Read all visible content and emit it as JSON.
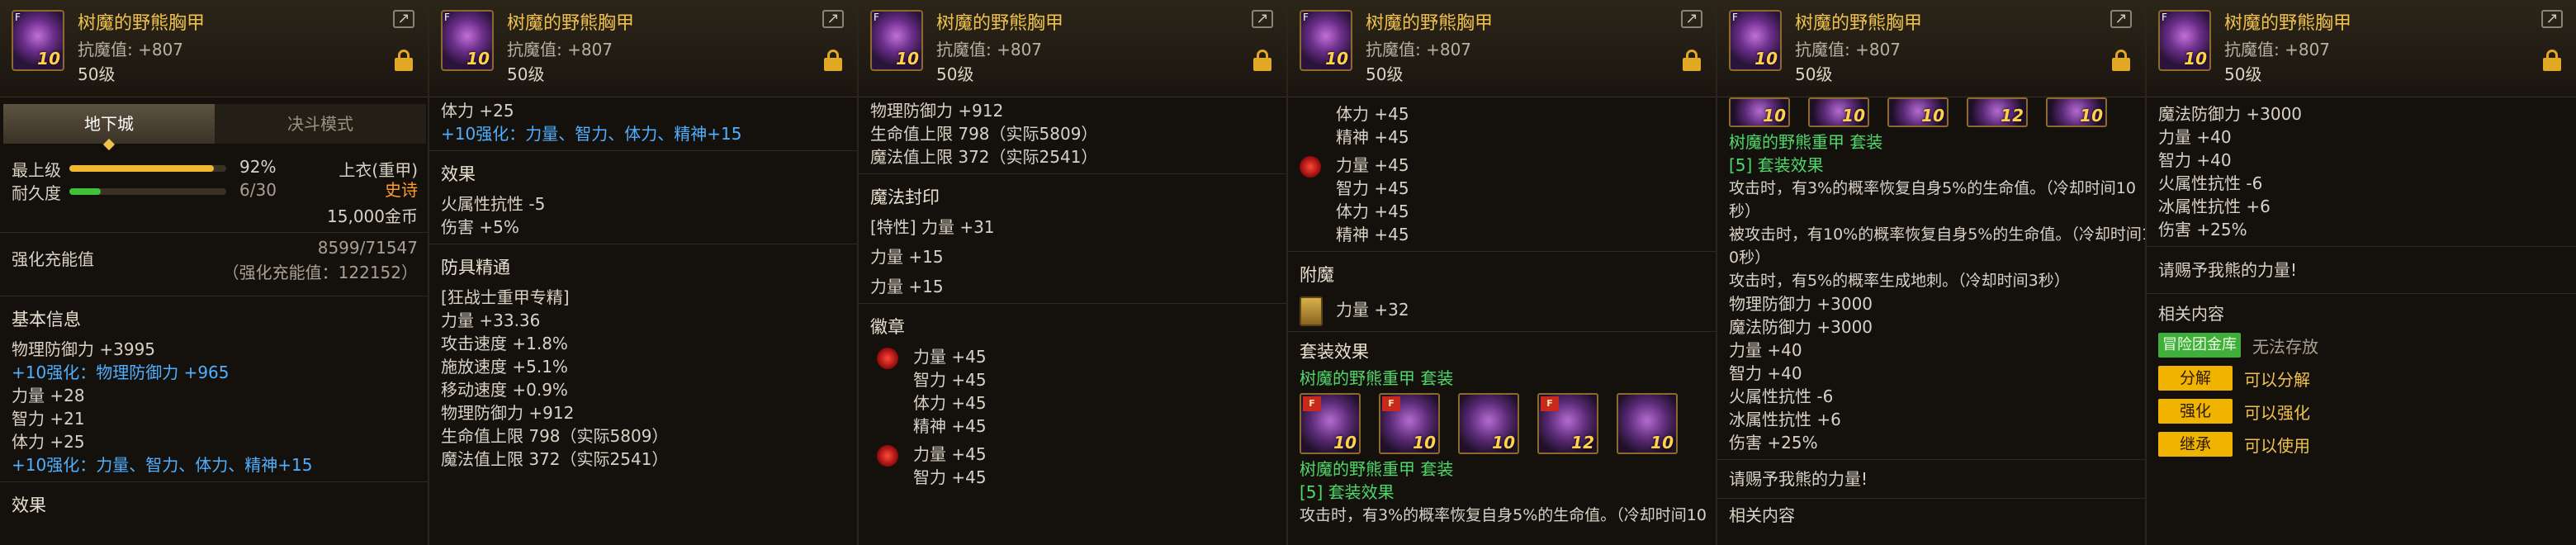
{
  "item": {
    "name": "树魔的野熊胸甲",
    "resist": "抗魔值: +807",
    "level": "50级",
    "icon_badge": "F",
    "icon_level": "10",
    "share_icon": "share-icon",
    "lock_icon": "lock-icon"
  },
  "p1": {
    "tab_dungeon": "地下城",
    "tab_duel": "决斗模式",
    "max_level_label": "最上级",
    "max_level_pct": "92%",
    "max_level_value": 0.92,
    "durability_label": "耐久度",
    "durability_value": "6/30",
    "durability_frac": 0.2,
    "slot": "上衣(重甲)",
    "rarity": "史诗",
    "price": "15,000金币",
    "enhance_label": "强化充能值",
    "enhance_value": "8599/71547",
    "enhance_sub": "（强化充能值：122152）",
    "basic_info": "基本信息",
    "lines": [
      "物理防御力 +3995",
      "+10强化：物理防御力 +965",
      "力量 +28",
      "智力 +21",
      "体力 +25",
      "+10强化：力量、智力、体力、精神+15"
    ],
    "effect": "效果"
  },
  "p2": {
    "top": [
      "体力 +25",
      "+10强化：力量、智力、体力、精神+15"
    ],
    "effect": "效果",
    "effect_lines": [
      "火属性抗性 -5",
      "伤害 +5%"
    ],
    "mastery": "防具精通",
    "mastery_lines": [
      "[狂战士重甲专精]",
      "力量 +33.36",
      "攻击速度 +1.8%",
      "施放速度 +5.1%",
      "移动速度 +0.9%",
      "物理防御力 +912",
      "生命值上限 798（实际5809）",
      "魔法值上限 372（实际2541）"
    ]
  },
  "p3": {
    "top": [
      "物理防御力 +912",
      "生命值上限 798（实际5809）",
      "魔法值上限 372（实际2541）"
    ],
    "seal": "魔法封印",
    "seal_line": "[特性] 力量 +31",
    "seal_lines": [
      "力量 +15",
      "力量 +15"
    ],
    "emblem": "徽章",
    "emblem_a": [
      "力量 +45",
      "智力 +45",
      "体力 +45",
      "精神 +45"
    ],
    "emblem_b": [
      "力量 +45",
      "智力 +45"
    ]
  },
  "p4": {
    "top": [
      "体力 +45",
      "精神 +45"
    ],
    "emblem_a": [
      "力量 +45",
      "智力 +45",
      "体力 +45",
      "精神 +45"
    ],
    "enchant": "附魔",
    "enchant_line": "力量 +32",
    "set_effect": "套装效果",
    "set_name": "树魔的野熊重甲  套装",
    "set_levels": [
      "10",
      "10",
      "10",
      "12",
      "10"
    ],
    "set_sub_name": "树魔的野熊重甲  套装",
    "set_5": "[5] 套装效果",
    "set_5_line": "攻击时，有3%的概率恢复自身5%的生命值。（冷却时间10"
  },
  "p5": {
    "icon_levels": [
      "10",
      "10",
      "10",
      "12",
      "10"
    ],
    "set_sub_name": "树魔的野熊重甲  套装",
    "set_5": "[5] 套装效果",
    "lines_a": [
      "攻击时，有3%的概率恢复自身5%的生命值。（冷却时间10",
      "秒）",
      "被攻击时，有10%的概率恢复自身5%的生命值。（冷却时间1",
      "0秒）",
      "攻击时，有5%的概率生成地刺。（冷却时间3秒）"
    ],
    "lines_b": [
      "物理防御力 +3000",
      "魔法防御力 +3000",
      "力量 +40",
      "智力 +40",
      "火属性抗性 -6",
      "冰属性抗性 +6",
      "伤害 +25%"
    ],
    "quote": "请赐予我熊的力量!",
    "related": "相关内容"
  },
  "p6": {
    "lines": [
      "魔法防御力 +3000",
      "力量 +40",
      "智力 +40",
      "火属性抗性 -6",
      "冰属性抗性 +6",
      "伤害 +25%"
    ],
    "quote": "请赐予我熊的力量!",
    "related": "相关内容",
    "bank_btn": "冒险团金库",
    "bank_text": "无法存放",
    "disassemble_btn": "分解",
    "disassemble_text": "可以分解",
    "enhance_btn": "强化",
    "enhance_text": "可以强化",
    "inherit_btn": "继承",
    "inherit_text": "可以使用"
  }
}
